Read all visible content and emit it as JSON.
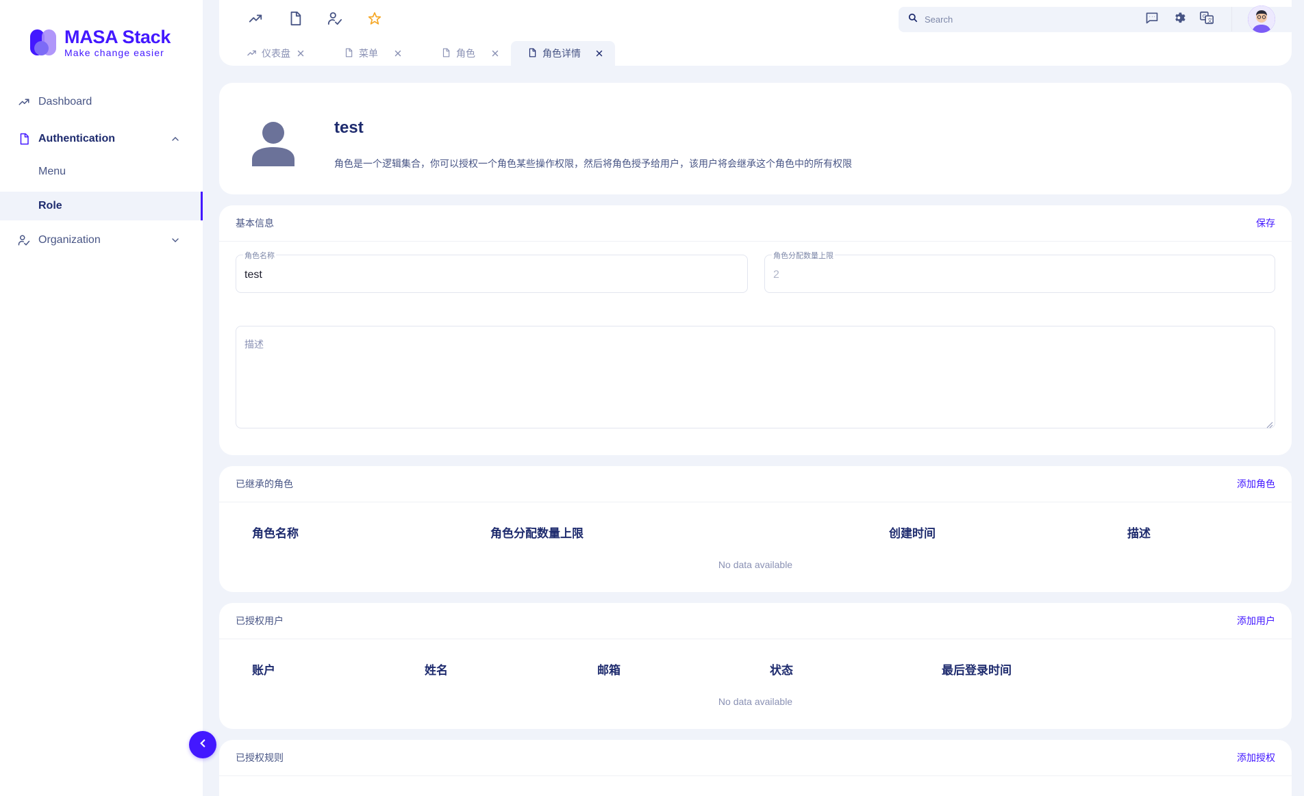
{
  "brand": {
    "title": "MASA Stack",
    "subtitle": "Make change easier",
    "accent": "#4318ff"
  },
  "sidebar": {
    "items": [
      {
        "label": "Dashboard",
        "icon": "trending-up-icon"
      },
      {
        "label": "Authentication",
        "icon": "file-icon",
        "expanded": true,
        "children": [
          {
            "label": "Menu"
          },
          {
            "label": "Role",
            "selected": true
          }
        ]
      },
      {
        "label": "Organization",
        "icon": "user-check-icon",
        "expanded": false
      }
    ]
  },
  "topbar": {
    "quick_icons": [
      "trending-up-icon",
      "file-icon",
      "user-check-icon",
      "star-icon"
    ],
    "search_placeholder": "Search",
    "right_icons": [
      "message-icon",
      "gear-icon",
      "translate-icon"
    ]
  },
  "tabs": [
    {
      "label": "仪表盘",
      "icon": "trending-up-icon",
      "active": false
    },
    {
      "label": "菜单",
      "icon": "file-icon",
      "active": false
    },
    {
      "label": "角色",
      "icon": "file-icon",
      "active": false
    },
    {
      "label": "角色详情",
      "icon": "file-icon",
      "active": true
    }
  ],
  "profile": {
    "name": "test",
    "description": "角色是一个逻辑集合，你可以授权一个角色某些操作权限，然后将角色授予给用户，该用户将会继承这个角色中的所有权限"
  },
  "basic_info": {
    "title": "基本信息",
    "save_label": "保存",
    "role_name_label": "角色名称",
    "role_name_value": "test",
    "limit_label": "角色分配数量上限",
    "limit_value": "2",
    "description_placeholder": "描述"
  },
  "inherited_roles": {
    "title": "已继承的角色",
    "action_label": "添加角色",
    "columns": [
      "角色名称",
      "角色分配数量上限",
      "创建时间",
      "描述"
    ],
    "rows": [],
    "empty_text": "No data available"
  },
  "authorized_users": {
    "title": "已授权用户",
    "action_label": "添加用户",
    "columns": [
      "账户",
      "姓名",
      "邮箱",
      "状态",
      "最后登录时间"
    ],
    "rows": [],
    "empty_text": "No data available"
  },
  "authorized_rules": {
    "title": "已授权规则",
    "action_label": "添加授权"
  }
}
